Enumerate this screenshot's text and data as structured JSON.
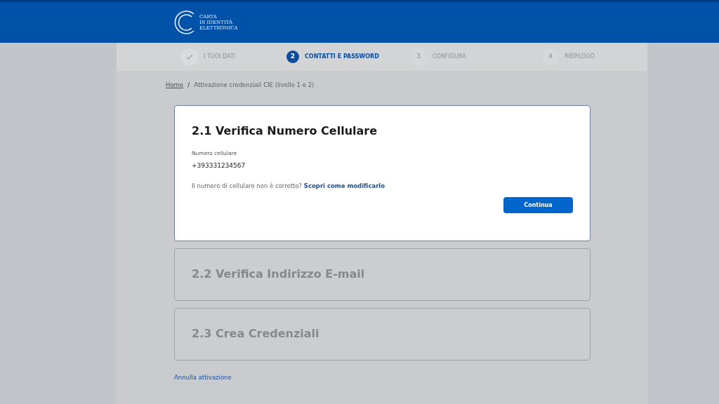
{
  "header": {
    "logo_lines": [
      "CARTA",
      "DI IDENTITÀ",
      "ELETTRONICA"
    ]
  },
  "steps": [
    {
      "label": "I TUOI DATI",
      "kind": "done",
      "selected": false
    },
    {
      "number": "2",
      "label": "CONTATTI E PASSWORD",
      "kind": "current",
      "selected": true
    },
    {
      "number": "3",
      "label": "CONFIGURA",
      "kind": "todo",
      "selected": false
    },
    {
      "number": "4",
      "label": "RIEPILOGO",
      "kind": "todo",
      "selected": false
    }
  ],
  "breadcrumb": {
    "home": "Home",
    "separator": "/",
    "current": "Attivazione credenziali CIE (livello 1 e 2)"
  },
  "sections": [
    {
      "title": "2.1 Verifica Numero Cellulare",
      "expanded": true,
      "field_label": "Numero cellulare",
      "field_value": "+393331234567",
      "hint": "Il numero di cellulare non è corretto?",
      "link": "Scopri come modificarlo",
      "button": "Continua"
    },
    {
      "title": "2.2 Verifica Indirizzo E-mail",
      "expanded": false
    },
    {
      "title": "2.3 Crea Credenziali",
      "expanded": false
    }
  ],
  "cancel_link": "Annulla attivazione"
}
